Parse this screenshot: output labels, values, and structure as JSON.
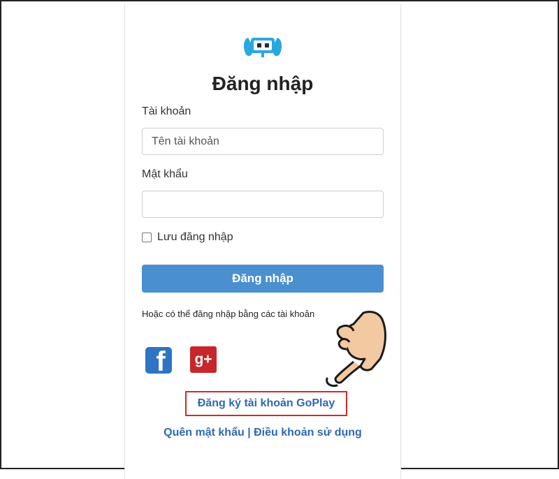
{
  "login": {
    "title": "Đăng nhập",
    "username_label": "Tài khoản",
    "username_placeholder": "Tên tài khoản",
    "password_label": "Mật khẩu",
    "password_value": "",
    "remember_label": "Lưu đăng nhập",
    "submit_label": "Đăng nhập",
    "social_prompt": "Hoặc có thể đăng nhập bằng các tài khoản",
    "facebook_glyph": "f",
    "google_glyph": "g+",
    "register_label": "Đăng ký tài khoản GoPlay",
    "forgot_label": "Quên mật khẩu",
    "separator": "|",
    "terms_label": "Điều khoản sử dụng"
  },
  "icons": {
    "logo": "goplay-logo-icon",
    "facebook": "facebook-icon",
    "google": "google-plus-icon",
    "pointer": "pointing-hand-icon"
  },
  "colors": {
    "primary_button": "#4a8fd0",
    "link": "#2f69b4",
    "highlight_border": "#d22a2a",
    "facebook": "#2f74c2",
    "google": "#c7262a",
    "logo": "#29a8e0",
    "hand_skin": "#f2c9a0"
  }
}
